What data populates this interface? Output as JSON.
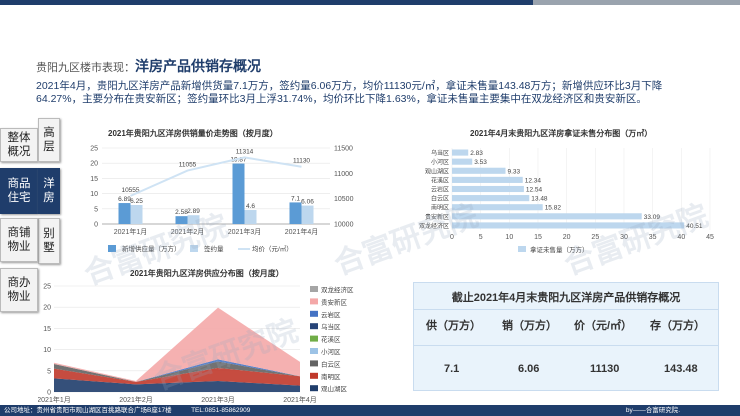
{
  "header": {
    "prefix": "贵阳九区楼市表现：",
    "title": "洋房产品供销存概况"
  },
  "description": "2021年4月，贵阳九区洋房产品新增供货量7.1万方，签约量6.06万方，均价11130元/㎡，拿证未售量143.48万方；新增供应环比3月下降64.27%，主要分布在贵安新区；签约量环比3月上浮31.74%，均价环比下降1.63%，拿证未售量主要集中在双龙经济区和贵安新区。",
  "nav": [
    {
      "label": "整体概况",
      "active": false
    },
    {
      "label": "高层",
      "active": false
    },
    {
      "label": "商品住宅",
      "active": true
    },
    {
      "label": "洋房",
      "active": true
    },
    {
      "label": "别墅",
      "active": false
    },
    {
      "label": "商铺物业",
      "active": false
    },
    {
      "label": "商办物业",
      "active": false
    }
  ],
  "chart_data": [
    {
      "type": "bar",
      "title": "2021年贵阳九区洋房供销量价走势图（按月度）",
      "categories": [
        "2021年1月",
        "2021年2月",
        "2021年3月",
        "2021年4月"
      ],
      "series": [
        {
          "name": "新增供应量（万方）",
          "values": [
            6.89,
            2.58,
            19.87,
            7.1
          ],
          "color": "#5b9bd5"
        },
        {
          "name": "签约量",
          "values": [
            6.25,
            2.89,
            4.6,
            6.06
          ],
          "color": "#bdd7ee"
        },
        {
          "name": "均价（元/㎡）",
          "values": [
            10555,
            11055,
            11314,
            11130
          ],
          "color": "#cfe3f4",
          "axis": "right",
          "type": "line"
        }
      ],
      "ylim": [
        0,
        25
      ],
      "yticks": [
        0,
        5,
        10,
        15,
        20,
        25
      ],
      "y2lim": [
        10000,
        11500
      ],
      "y2ticks": [
        10000,
        10500,
        11000,
        11500
      ]
    },
    {
      "type": "bar",
      "orientation": "horizontal",
      "title": "2021年4月末贵阳九区洋房拿证未售分布图（万㎡）",
      "categories": [
        "乌当区",
        "小河区",
        "观山湖区",
        "花溪区",
        "云岩区",
        "白云区",
        "南明区",
        "贵安新区",
        "双龙经济区"
      ],
      "values": [
        2.83,
        3.53,
        9.33,
        12.34,
        12.54,
        13.48,
        15.82,
        33.09,
        40.51
      ],
      "series_name": "拿证未售量（万方）",
      "xlim": [
        0,
        45
      ],
      "xticks": [
        0,
        5,
        10,
        15,
        20,
        25,
        30,
        35,
        40,
        45
      ],
      "color": "#bdd7ee"
    },
    {
      "type": "area",
      "title": "2021年贵阳九区洋房供应分布图（按月度）",
      "categories": [
        "2021年1月",
        "2021年2月",
        "2021年3月",
        "2021年4月"
      ],
      "ylim": [
        0,
        25
      ],
      "yticks": [
        0,
        5,
        10,
        15,
        20,
        25
      ],
      "series": [
        {
          "name": "双龙经济区",
          "values": [
            0,
            0,
            0,
            0
          ],
          "color": "#a5a5a5"
        },
        {
          "name": "贵安新区",
          "values": [
            0.3,
            0.2,
            12.2,
            3.4
          ],
          "color": "#f4a8a8"
        },
        {
          "name": "云岩区",
          "values": [
            0,
            0,
            0.5,
            0
          ],
          "color": "#4472c4"
        },
        {
          "name": "乌当区",
          "values": [
            0,
            0,
            0,
            0
          ],
          "color": "#264478"
        },
        {
          "name": "花溪区",
          "values": [
            0,
            0,
            0,
            0
          ],
          "color": "#70ad47"
        },
        {
          "name": "小河区",
          "values": [
            0,
            0,
            0,
            0
          ],
          "color": "#9dc3e6"
        },
        {
          "name": "白云区",
          "values": [
            1.1,
            0,
            1.5,
            0
          ],
          "color": "#636363"
        },
        {
          "name": "南明区",
          "values": [
            2.3,
            0.6,
            3.1,
            2.2
          ],
          "color": "#c0392b"
        },
        {
          "name": "观山湖区",
          "values": [
            3.2,
            1.8,
            2.6,
            1.5
          ],
          "color": "#1f3d6b"
        }
      ]
    }
  ],
  "summary": {
    "title": "截止2021年4月末贵阳九区洋房产品供销存概况",
    "headers": [
      "供（万方）",
      "销（万方）",
      "价（元/㎡）",
      "存（万方）"
    ],
    "values": [
      "7.1",
      "6.06",
      "11130",
      "143.48"
    ]
  },
  "watermark": "合富研究院",
  "footer": {
    "left": "公司地址：贵州省贵阳市观山湖区百挑路联合广场B座17楼　　　TEL:0851-85862909",
    "right": "by——合富研究院."
  }
}
